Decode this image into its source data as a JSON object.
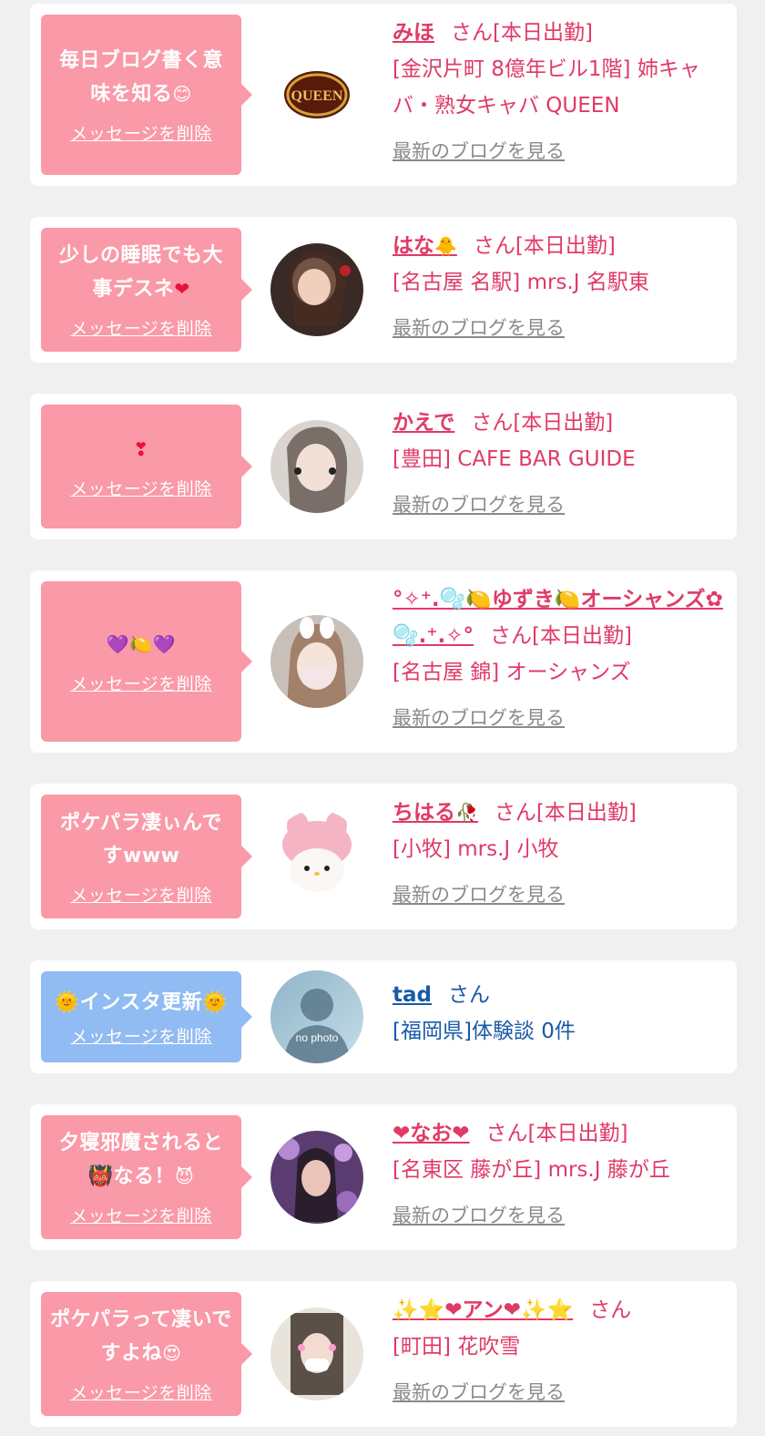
{
  "entries": [
    {
      "message": "毎日ブログ書く意味を知る",
      "message_emoji": "😊",
      "delete_label": "メッセージを削除",
      "name": "みほ",
      "suffix": "さん[本日出勤]",
      "shop": "[金沢片町 8億年ビル1階] 姉キャバ・熟女キャバ QUEEN",
      "blog_link": "最新のブログを見る",
      "avatar_text": "QUEEN"
    },
    {
      "message": "少しの睡眠でも大事デスネ",
      "message_emoji": "❤",
      "delete_label": "メッセージを削除",
      "name": "はな",
      "name_emoji": "🐥",
      "suffix": "さん[本日出勤]",
      "shop": "[名古屋 名駅] mrs.J 名駅東",
      "blog_link": "最新のブログを見る"
    },
    {
      "message": "",
      "message_emoji": "❣",
      "delete_label": "メッセージを削除",
      "name": "かえで",
      "suffix": "さん[本日出勤]",
      "shop": "[豊田] CAFE BAR GUIDE",
      "blog_link": "最新のブログを見る"
    },
    {
      "message": "",
      "message_emoji": "💜🍋💜",
      "delete_label": "メッセージを削除",
      "name": "°✧⁺.🫧🍋ゆずき🍋オーシャンズ✿🫧.⁺.✧°",
      "suffix": "さん[本日出勤]",
      "shop": "[名古屋 錦] オーシャンズ",
      "blog_link": "最新のブログを見る"
    },
    {
      "message": "ポケパラ凄ぃんですwww",
      "message_emoji": "",
      "delete_label": "メッセージを削除",
      "name": "ちはる",
      "name_emoji": "🥀",
      "suffix": "さん[本日出勤]",
      "shop": "[小牧] mrs.J 小牧",
      "blog_link": "最新のブログを見る"
    },
    {
      "message": "🌞インスタ更新🌞",
      "message_emoji": "",
      "delete_label": "メッセージを削除",
      "name": "tad",
      "suffix": "さん",
      "shop": "[福岡県]体験談 0件",
      "avatar_text": "no photo"
    },
    {
      "message": "夕寝邪魔されると👹なる！",
      "message_emoji": "😈",
      "delete_label": "メッセージを削除",
      "name": "❤なお❤",
      "suffix": "さん[本日出勤]",
      "shop": "[名東区 藤が丘] mrs.J 藤が丘",
      "blog_link": "最新のブログを見る"
    },
    {
      "message": "ポケパラって凄いですよね",
      "message_emoji": "😍",
      "delete_label": "メッセージを削除",
      "name": "✨⭐❤アン❤✨⭐",
      "suffix": "さん",
      "shop": "[町田] 花吹雪",
      "blog_link": "最新のブログを見る"
    }
  ],
  "colors": {
    "bubble_pink": "#fa99a7",
    "bubble_blue": "#90bbf3",
    "name_pink": "#e03a66",
    "name_blue": "#1a5aa8",
    "link_gray": "#8a8a8a",
    "page_bg": "#f0f0f0"
  }
}
